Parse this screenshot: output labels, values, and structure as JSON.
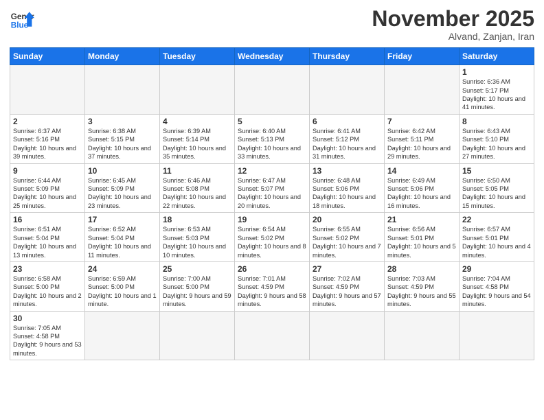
{
  "header": {
    "logo_general": "General",
    "logo_blue": "Blue",
    "month_title": "November 2025",
    "subtitle": "Alvand, Zanjan, Iran"
  },
  "weekdays": [
    "Sunday",
    "Monday",
    "Tuesday",
    "Wednesday",
    "Thursday",
    "Friday",
    "Saturday"
  ],
  "weeks": [
    [
      {
        "day": "",
        "info": ""
      },
      {
        "day": "",
        "info": ""
      },
      {
        "day": "",
        "info": ""
      },
      {
        "day": "",
        "info": ""
      },
      {
        "day": "",
        "info": ""
      },
      {
        "day": "",
        "info": ""
      },
      {
        "day": "1",
        "info": "Sunrise: 6:36 AM\nSunset: 5:17 PM\nDaylight: 10 hours\nand 41 minutes."
      }
    ],
    [
      {
        "day": "2",
        "info": "Sunrise: 6:37 AM\nSunset: 5:16 PM\nDaylight: 10 hours\nand 39 minutes."
      },
      {
        "day": "3",
        "info": "Sunrise: 6:38 AM\nSunset: 5:15 PM\nDaylight: 10 hours\nand 37 minutes."
      },
      {
        "day": "4",
        "info": "Sunrise: 6:39 AM\nSunset: 5:14 PM\nDaylight: 10 hours\nand 35 minutes."
      },
      {
        "day": "5",
        "info": "Sunrise: 6:40 AM\nSunset: 5:13 PM\nDaylight: 10 hours\nand 33 minutes."
      },
      {
        "day": "6",
        "info": "Sunrise: 6:41 AM\nSunset: 5:12 PM\nDaylight: 10 hours\nand 31 minutes."
      },
      {
        "day": "7",
        "info": "Sunrise: 6:42 AM\nSunset: 5:11 PM\nDaylight: 10 hours\nand 29 minutes."
      },
      {
        "day": "8",
        "info": "Sunrise: 6:43 AM\nSunset: 5:10 PM\nDaylight: 10 hours\nand 27 minutes."
      }
    ],
    [
      {
        "day": "9",
        "info": "Sunrise: 6:44 AM\nSunset: 5:09 PM\nDaylight: 10 hours\nand 25 minutes."
      },
      {
        "day": "10",
        "info": "Sunrise: 6:45 AM\nSunset: 5:09 PM\nDaylight: 10 hours\nand 23 minutes."
      },
      {
        "day": "11",
        "info": "Sunrise: 6:46 AM\nSunset: 5:08 PM\nDaylight: 10 hours\nand 22 minutes."
      },
      {
        "day": "12",
        "info": "Sunrise: 6:47 AM\nSunset: 5:07 PM\nDaylight: 10 hours\nand 20 minutes."
      },
      {
        "day": "13",
        "info": "Sunrise: 6:48 AM\nSunset: 5:06 PM\nDaylight: 10 hours\nand 18 minutes."
      },
      {
        "day": "14",
        "info": "Sunrise: 6:49 AM\nSunset: 5:06 PM\nDaylight: 10 hours\nand 16 minutes."
      },
      {
        "day": "15",
        "info": "Sunrise: 6:50 AM\nSunset: 5:05 PM\nDaylight: 10 hours\nand 15 minutes."
      }
    ],
    [
      {
        "day": "16",
        "info": "Sunrise: 6:51 AM\nSunset: 5:04 PM\nDaylight: 10 hours\nand 13 minutes."
      },
      {
        "day": "17",
        "info": "Sunrise: 6:52 AM\nSunset: 5:04 PM\nDaylight: 10 hours\nand 11 minutes."
      },
      {
        "day": "18",
        "info": "Sunrise: 6:53 AM\nSunset: 5:03 PM\nDaylight: 10 hours\nand 10 minutes."
      },
      {
        "day": "19",
        "info": "Sunrise: 6:54 AM\nSunset: 5:02 PM\nDaylight: 10 hours\nand 8 minutes."
      },
      {
        "day": "20",
        "info": "Sunrise: 6:55 AM\nSunset: 5:02 PM\nDaylight: 10 hours\nand 7 minutes."
      },
      {
        "day": "21",
        "info": "Sunrise: 6:56 AM\nSunset: 5:01 PM\nDaylight: 10 hours\nand 5 minutes."
      },
      {
        "day": "22",
        "info": "Sunrise: 6:57 AM\nSunset: 5:01 PM\nDaylight: 10 hours\nand 4 minutes."
      }
    ],
    [
      {
        "day": "23",
        "info": "Sunrise: 6:58 AM\nSunset: 5:00 PM\nDaylight: 10 hours\nand 2 minutes."
      },
      {
        "day": "24",
        "info": "Sunrise: 6:59 AM\nSunset: 5:00 PM\nDaylight: 10 hours\nand 1 minute."
      },
      {
        "day": "25",
        "info": "Sunrise: 7:00 AM\nSunset: 5:00 PM\nDaylight: 9 hours\nand 59 minutes."
      },
      {
        "day": "26",
        "info": "Sunrise: 7:01 AM\nSunset: 4:59 PM\nDaylight: 9 hours\nand 58 minutes."
      },
      {
        "day": "27",
        "info": "Sunrise: 7:02 AM\nSunset: 4:59 PM\nDaylight: 9 hours\nand 57 minutes."
      },
      {
        "day": "28",
        "info": "Sunrise: 7:03 AM\nSunset: 4:59 PM\nDaylight: 9 hours\nand 55 minutes."
      },
      {
        "day": "29",
        "info": "Sunrise: 7:04 AM\nSunset: 4:58 PM\nDaylight: 9 hours\nand 54 minutes."
      }
    ],
    [
      {
        "day": "30",
        "info": "Sunrise: 7:05 AM\nSunset: 4:58 PM\nDaylight: 9 hours\nand 53 minutes."
      },
      {
        "day": "",
        "info": ""
      },
      {
        "day": "",
        "info": ""
      },
      {
        "day": "",
        "info": ""
      },
      {
        "day": "",
        "info": ""
      },
      {
        "day": "",
        "info": ""
      },
      {
        "day": "",
        "info": ""
      }
    ]
  ]
}
